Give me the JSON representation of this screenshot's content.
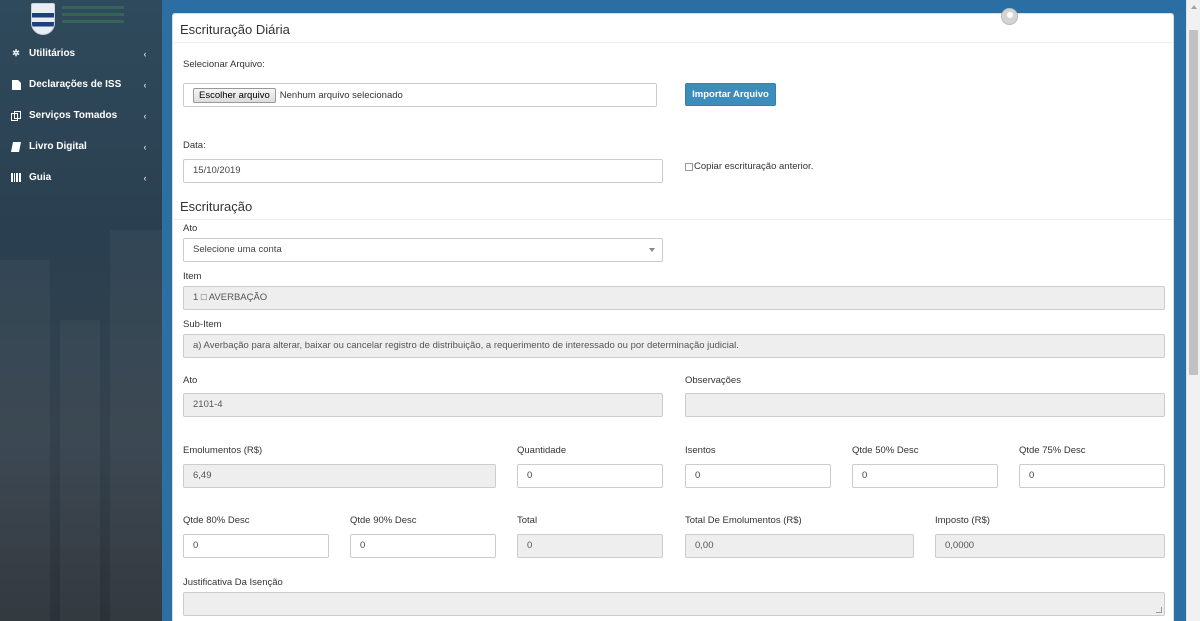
{
  "sidebar": {
    "items": [
      {
        "label": "Utilitários",
        "icon": "gear-icon"
      },
      {
        "label": "Declarações de ISS",
        "icon": "file-icon"
      },
      {
        "label": "Serviços Tomados",
        "icon": "copy-icon"
      },
      {
        "label": "Livro Digital",
        "icon": "book-icon"
      },
      {
        "label": "Guia",
        "icon": "barcode-icon"
      }
    ],
    "chevron": "‹"
  },
  "panel": {
    "title": "Escrituração Diária",
    "select_file_label": "Selecionar Arquivo:",
    "file_button": "Escolher arquivo",
    "file_status": "Nenhum arquivo selecionado",
    "import_button": "Importar Arquivo",
    "date_label": "Data:",
    "date_value": "15/10/2019",
    "copy_label": "Copiar escrituração anterior.",
    "section_title": "Escrituração"
  },
  "form": {
    "ato_select_label": "Ato",
    "ato_select_value": "Selecione uma conta",
    "item_label": "Item",
    "item_value": "1 □ AVERBAÇÃO",
    "subitem_label": "Sub-Item",
    "subitem_value": "a) Averbação para alterar, baixar ou cancelar registro de distribuição, a requerimento de interessado ou por determinação judicial.",
    "ato_label": "Ato",
    "ato_value": "2101-4",
    "observacoes_label": "Observações",
    "observacoes_value": "",
    "emolumentos_label": "Emolumentos (R$)",
    "emolumentos_value": "6,49",
    "quantidade_label": "Quantidade",
    "quantidade_value": "0",
    "isentos_label": "Isentos",
    "isentos_value": "0",
    "qtde50_label": "Qtde 50% Desc",
    "qtde50_value": "0",
    "qtde75_label": "Qtde 75% Desc",
    "qtde75_value": "0",
    "qtde80_label": "Qtde 80% Desc",
    "qtde80_value": "0",
    "qtde90_label": "Qtde 90% Desc",
    "qtde90_value": "0",
    "total_label": "Total",
    "total_value": "0",
    "total_emol_label": "Total De Emolumentos (R$)",
    "total_emol_value": "0,00",
    "imposto_label": "Imposto (R$)",
    "imposto_value": "0,0000",
    "justificativa_label": "Justificativa Da Isenção"
  },
  "colors": {
    "accent": "#3c8dbc",
    "sidebar": "#2f4a5c",
    "topbar": "#2a6ea3"
  }
}
